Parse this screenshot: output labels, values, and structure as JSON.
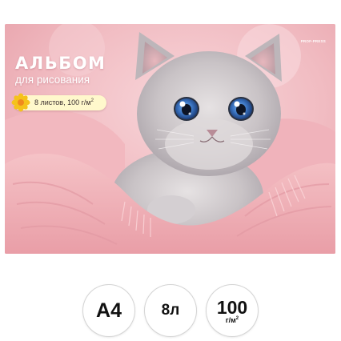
{
  "cover": {
    "brand": "PROF-PRESS",
    "title": "АЛЬБОМ",
    "subtitle": "для рисования",
    "info_prefix": "8 листов, 100 г/м",
    "info_sup": "2",
    "background_color": "#f0b7bd",
    "pill_color": "#fff8cc",
    "flower_icon": "flower-icon",
    "image_subject": "cat"
  },
  "badges": {
    "format": "А4",
    "sheets": "8л",
    "density_value": "100",
    "density_unit": "г/м",
    "density_sup": "2"
  }
}
